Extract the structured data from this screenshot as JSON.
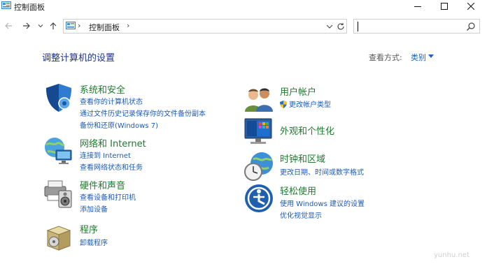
{
  "window": {
    "title": "控制面板",
    "watermark": "yunhu.net"
  },
  "address": {
    "separator": "›",
    "crumb": "控制面板",
    "search_placeholder": ""
  },
  "header": {
    "title": "调整计算机的设置",
    "view_by_label": "查看方式:",
    "view_by_value": "类别"
  },
  "categories": [
    {
      "title": "系统和安全",
      "icon": "shield-icon",
      "links": [
        "查看你的计算机状态",
        "通过文件历史记录保存你的文件备份副本",
        "备份和还原(Windows 7)"
      ]
    },
    {
      "title": "网络和 Internet",
      "icon": "network-globe-icon",
      "links": [
        "连接到 Internet",
        "查看网络状态和任务"
      ]
    },
    {
      "title": "硬件和声音",
      "icon": "printer-speaker-icon",
      "links": [
        "查看设备和打印机",
        "添加设备"
      ]
    },
    {
      "title": "程序",
      "icon": "programs-box-icon",
      "links": [
        "卸载程序"
      ]
    },
    {
      "title": "用户帐户",
      "icon": "users-icon",
      "links": [
        "更改帐户类型"
      ]
    },
    {
      "title": "外观和个性化",
      "icon": "monitor-icon",
      "links": []
    },
    {
      "title": "时钟和区域",
      "icon": "clock-globe-icon",
      "links": [
        "更改日期、时间或数字格式"
      ]
    },
    {
      "title": "轻松使用",
      "icon": "ease-of-access-icon",
      "links": [
        "使用 Windows 建议的设置",
        "优化视觉显示"
      ]
    }
  ],
  "colors": {
    "category_title": "#1f7a2e",
    "link": "#1c5bb8",
    "heading": "#1e3287"
  }
}
